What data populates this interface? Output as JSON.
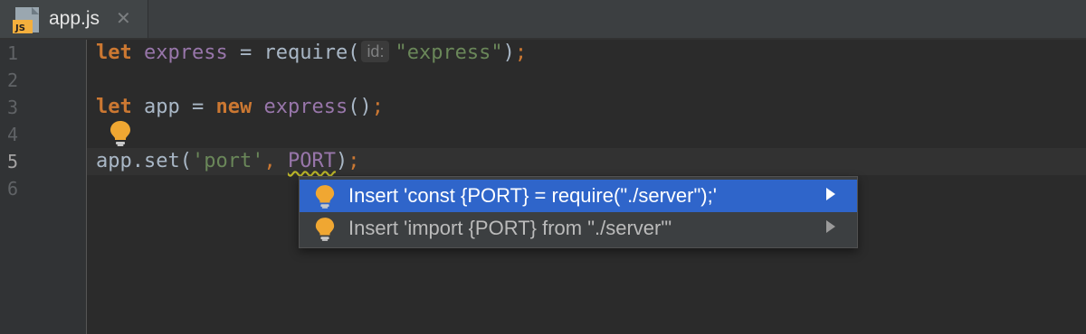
{
  "tab": {
    "label": "app.js",
    "icon": "js-file-icon",
    "icon_text": "JS",
    "close_icon": "close-icon"
  },
  "gutter": {
    "line_numbers": [
      "1",
      "2",
      "3",
      "4",
      "5",
      "6"
    ],
    "active_line": "5"
  },
  "code": {
    "line1": {
      "kw_let": "let",
      "var": "express",
      "eq": "=",
      "fn": "require(",
      "hint": "id:",
      "arg": "\"express\"",
      "close": ")",
      "semi": ";"
    },
    "line3": {
      "kw_let": "let",
      "var": "app",
      "eq": "=",
      "kw_new": "new",
      "fn": "express",
      "parens": "()",
      "semi": ";"
    },
    "line5": {
      "obj": "app.",
      "method": "set",
      "open": "(",
      "arg1": "'port'",
      "comma": ",",
      "arg2": "PORT",
      "close": ")",
      "semi": ";"
    }
  },
  "gutter_icon": "lightbulb-icon",
  "popup": {
    "items": [
      {
        "label": "Insert 'const {PORT} = require(\"./server\");'",
        "selected": true,
        "icon": "lightbulb-icon"
      },
      {
        "label": "Insert 'import {PORT} from \"./server\"'",
        "selected": false,
        "icon": "lightbulb-icon"
      }
    ]
  },
  "colors": {
    "keyword": "#cc7832",
    "function": "#9876aa",
    "string": "#6a8759",
    "text": "#a9b7c6",
    "selection": "#2f65ca",
    "bulb": "#f0a732"
  }
}
